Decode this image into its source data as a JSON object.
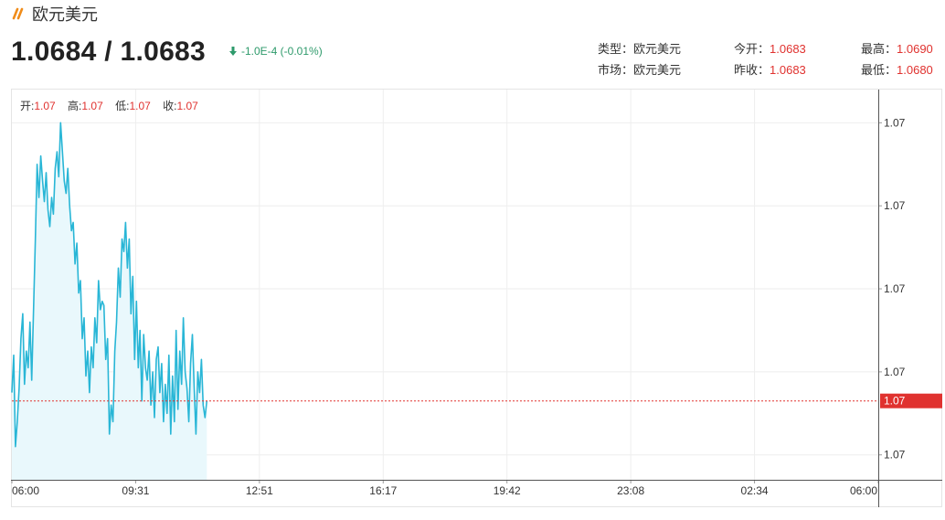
{
  "header": {
    "title": "欧元美元",
    "logo_icon": "double-slash-icon",
    "logo_color": "#f08c1a"
  },
  "quote": {
    "price": "1.0684 / 1.0683",
    "change": "-1.0E-4 (-0.01%)",
    "change_icon": "arrow-down-icon",
    "change_color": "#2e9a6b"
  },
  "info": {
    "type_label": "类型：",
    "type_value": "欧元美元",
    "market_label": "市场：",
    "market_value": "欧元美元",
    "open_label": "今开：",
    "open_value": "1.0683",
    "prev_close_label": "昨收：",
    "prev_close_value": "1.0683",
    "high_label": "最高：",
    "high_value": "1.0690",
    "low_label": "最低：",
    "low_value": "1.0680"
  },
  "ohlc": {
    "open_label": "开:",
    "open_value": "1.07",
    "high_label": "高:",
    "high_value": "1.07",
    "low_label": "低:",
    "low_value": "1.07",
    "close_label": "收:",
    "close_value": "1.07"
  },
  "chart_data": {
    "type": "area",
    "x_tick_labels": [
      "06:00",
      "09:31",
      "12:51",
      "16:17",
      "19:42",
      "23:08",
      "02:34",
      "06:00"
    ],
    "y_tick_labels": [
      "1.07",
      "1.07",
      "1.07",
      "1.07",
      "1.07"
    ],
    "y_tick_values": [
      1.0689,
      1.0687,
      1.0685,
      1.0683,
      1.0681
    ],
    "ylim": [
      1.06804,
      1.06898
    ],
    "current_label": "1.07",
    "current_value": 1.06823,
    "grid": true,
    "line_color": "#29b6d6",
    "fill_color": "#e9f8fc",
    "current_color": "#e0322f",
    "x_hours": [
      0,
      0.05,
      0.1,
      0.15,
      0.2,
      0.25,
      0.3,
      0.35,
      0.4,
      0.45,
      0.5,
      0.55,
      0.6,
      0.65,
      0.7,
      0.75,
      0.8,
      0.85,
      0.9,
      0.95,
      1.0,
      1.05,
      1.1,
      1.15,
      1.2,
      1.25,
      1.3,
      1.35,
      1.4,
      1.45,
      1.5,
      1.55,
      1.6,
      1.65,
      1.7,
      1.75,
      1.8,
      1.85,
      1.9,
      1.95,
      2.0,
      2.05,
      2.1,
      2.15,
      2.2,
      2.25,
      2.3,
      2.35,
      2.4,
      2.45,
      2.5,
      2.55,
      2.6,
      2.65,
      2.7,
      2.75,
      2.8,
      2.85,
      2.9,
      2.95,
      3.0,
      3.05,
      3.1,
      3.15,
      3.2,
      3.25,
      3.3,
      3.35,
      3.4,
      3.45,
      3.5,
      3.55,
      3.6,
      3.65,
      3.7,
      3.75,
      3.8,
      3.85,
      3.9,
      3.95,
      4.0,
      4.05,
      4.1,
      4.15,
      4.2,
      4.25,
      4.3,
      4.35,
      4.4,
      4.45,
      4.5,
      4.55,
      4.6,
      4.65,
      4.7,
      4.75,
      4.8,
      4.85,
      4.9,
      4.95,
      5.0,
      5.05,
      5.1,
      5.15,
      5.2,
      5.25,
      5.3,
      5.35,
      5.4
    ],
    "values": [
      1.06825,
      1.06834,
      1.06812,
      1.06818,
      1.06826,
      1.06838,
      1.06844,
      1.06827,
      1.06835,
      1.06831,
      1.06842,
      1.06828,
      1.06845,
      1.06862,
      1.0688,
      1.06872,
      1.06882,
      1.06876,
      1.06871,
      1.06878,
      1.06869,
      1.06865,
      1.06872,
      1.06868,
      1.06879,
      1.06883,
      1.06877,
      1.0689,
      1.06883,
      1.06876,
      1.06873,
      1.06879,
      1.0687,
      1.06864,
      1.06866,
      1.06856,
      1.06861,
      1.06849,
      1.06852,
      1.06838,
      1.06843,
      1.06829,
      1.06835,
      1.06825,
      1.06836,
      1.06831,
      1.06843,
      1.06837,
      1.06852,
      1.06845,
      1.06847,
      1.06846,
      1.06833,
      1.06838,
      1.06815,
      1.06822,
      1.06818,
      1.06835,
      1.06842,
      1.06855,
      1.06848,
      1.06862,
      1.06859,
      1.06866,
      1.06855,
      1.06862,
      1.06844,
      1.06853,
      1.06833,
      1.06847,
      1.06831,
      1.0684,
      1.06823,
      1.06839,
      1.06831,
      1.06828,
      1.06835,
      1.06822,
      1.0683,
      1.06819,
      1.06833,
      1.06836,
      1.06825,
      1.06832,
      1.06818,
      1.06827,
      1.0682,
      1.06834,
      1.06815,
      1.06829,
      1.06818,
      1.0684,
      1.06821,
      1.06835,
      1.06827,
      1.06843,
      1.0683,
      1.06826,
      1.06818,
      1.06832,
      1.06839,
      1.06826,
      1.06815,
      1.0683,
      1.06825,
      1.06833,
      1.06822,
      1.06819,
      1.06823
    ]
  }
}
